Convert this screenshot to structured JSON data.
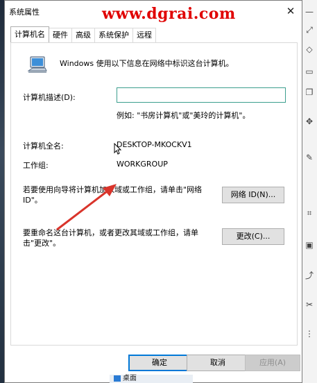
{
  "window": {
    "title": "系统属性",
    "close_glyph": "✕"
  },
  "watermark": "www.dgrai.com",
  "tabs": [
    {
      "label": "计算机名",
      "active": true
    },
    {
      "label": "硬件",
      "active": false
    },
    {
      "label": "高级",
      "active": false
    },
    {
      "label": "系统保护",
      "active": false
    },
    {
      "label": "远程",
      "active": false
    }
  ],
  "computer_name_tab": {
    "intro": "Windows 使用以下信息在网络中标识这台计算机。",
    "description_label": "计算机描述(D):",
    "description_value": "",
    "description_example": "例如: \"书房计算机\"或\"美玲的计算机\"。",
    "full_name_label": "计算机全名:",
    "full_name_value": "DESKTOP-MKOCKV1",
    "workgroup_label": "工作组:",
    "workgroup_value": "WORKGROUP",
    "network_id_text": "若要使用向导将计算机加入域或工作组，请单击\"网络 ID\"。",
    "network_id_button": "网络 ID(N)...",
    "rename_text": "要重命名这台计算机，或者更改其域或工作组，请单击\"更改\"。",
    "change_button": "更改(C)..."
  },
  "footer": {
    "ok": "确定",
    "cancel": "取消",
    "apply": "应用(A)"
  },
  "taskbar_fragment": "桌面",
  "colors": {
    "accent": "#0078d7",
    "arrow": "#d9342b",
    "watermark": "#e00000"
  }
}
